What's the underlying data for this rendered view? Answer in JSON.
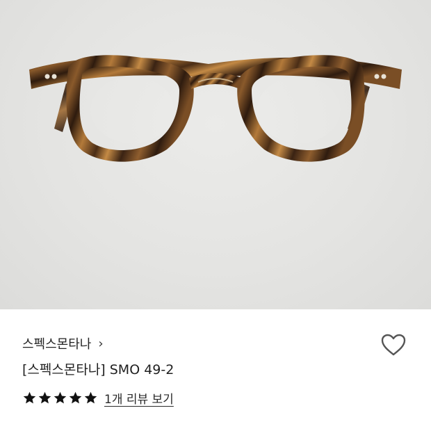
{
  "product": {
    "brand": "스펙스몬타나",
    "title": "[스펙스몬타나] SMO 49-2",
    "rating": 5,
    "review_link": "1개 리뷰 보기",
    "price": "",
    "image_alt": "glasses-photo"
  },
  "icons": {
    "brand_chevron": "chevron-right-icon",
    "wishlist": "heart-outline-icon",
    "rating": "star-icon"
  },
  "colors": {
    "photo_background": "#e6e6e4",
    "frame_tortoise_dark": "#3a2414",
    "frame_tortoise_light": "#b07a3c",
    "text_primary": "#1a1a1a",
    "heart_stroke": "#555555"
  }
}
